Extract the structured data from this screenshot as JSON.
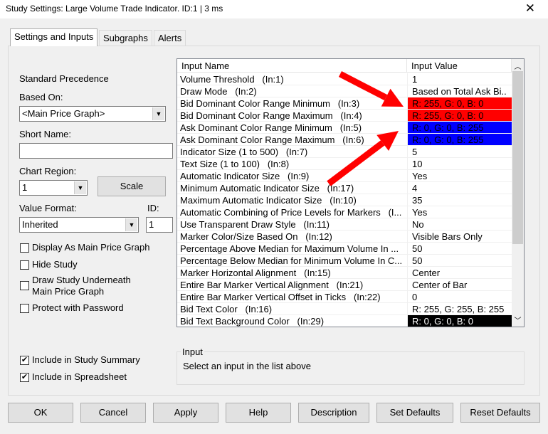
{
  "window": {
    "title": "Study Settings: Large Volume Trade Indicator. ID:1 | 3 ms",
    "close": "✕"
  },
  "tabs": [
    "Settings and Inputs",
    "Subgraphs",
    "Alerts"
  ],
  "left": {
    "standard_precedence": "Standard Precedence",
    "based_on_label": "Based On:",
    "based_on_value": "<Main Price Graph>",
    "short_name_label": "Short Name:",
    "short_name_value": "",
    "chart_region_label": "Chart Region:",
    "chart_region_value": "1",
    "scale_button": "Scale",
    "value_format_label": "Value Format:",
    "value_format_value": "Inherited",
    "id_label": "ID:",
    "id_value": "1",
    "checkboxes": [
      {
        "label": "Display As Main Price Graph",
        "checked": false
      },
      {
        "label": "Hide Study",
        "checked": false
      },
      {
        "label": "Draw Study Underneath Main Price Graph",
        "checked": false
      },
      {
        "label": "Protect with Password",
        "checked": false
      }
    ],
    "include_summary": {
      "label": "Include in Study Summary",
      "checked": true
    },
    "include_spreadsheet": {
      "label": "Include in Spreadsheet",
      "checked": true
    }
  },
  "inputs": {
    "columns": [
      "Input Name",
      "Input Value"
    ],
    "rows": [
      {
        "name": "Volume Threshold   (In:1)",
        "value": "1"
      },
      {
        "name": "Draw Mode   (In:2)",
        "value": "Based on Total Ask Bi.."
      },
      {
        "name": "Bid Dominant Color Range Minimum   (In:3)",
        "value": "R: 255, G: 0, B: 0",
        "bg": "#ff0000"
      },
      {
        "name": "Bid Dominant Color Range Maximum   (In:4)",
        "value": "R: 255, G: 0, B: 0",
        "bg": "#ff0000"
      },
      {
        "name": "Ask Dominant Color Range Minimum   (In:5)",
        "value": "R: 0, G: 0, B: 255",
        "bg": "#0000ff"
      },
      {
        "name": "Ask Dominant Color Range Maximum   (In:6)",
        "value": "R: 0, G: 0, B: 255",
        "bg": "#0000ff"
      },
      {
        "name": "Indicator Size (1 to 500)   (In:7)",
        "value": "5"
      },
      {
        "name": "Text Size (1 to 100)   (In:8)",
        "value": "10"
      },
      {
        "name": "Automatic Indicator Size   (In:9)",
        "value": "Yes"
      },
      {
        "name": "Minimum Automatic Indicator Size   (In:17)",
        "value": "4"
      },
      {
        "name": "Maximum Automatic Indicator Size   (In:10)",
        "value": "35"
      },
      {
        "name": "Automatic Combining of Price Levels for Markers   (I...",
        "value": "Yes"
      },
      {
        "name": "Use Transparent Draw Style   (In:11)",
        "value": "No"
      },
      {
        "name": "Marker Color/Size Based On   (In:12)",
        "value": "Visible Bars Only"
      },
      {
        "name": "Percentage Above Median for Maximum Volume In ...",
        "value": "50"
      },
      {
        "name": "Percentage Below Median for Minimum Volume In C...",
        "value": "50"
      },
      {
        "name": "Marker Horizontal Alignment   (In:15)",
        "value": "Center"
      },
      {
        "name": "Entire Bar Marker Vertical Alignment   (In:21)",
        "value": "Center of Bar"
      },
      {
        "name": "Entire Bar Marker Vertical Offset in Ticks   (In:22)",
        "value": "0"
      },
      {
        "name": "Bid Text Color   (In:16)",
        "value": "R: 255, G: 255, B: 255"
      },
      {
        "name": "Bid Text Background Color   (In:29)",
        "value": "R: 0, G: 0, B: 0",
        "bg": "#000000",
        "fg": "#ffffff"
      }
    ]
  },
  "input_group": {
    "title": "Input",
    "hint": "Select an input in the list above"
  },
  "buttons": [
    "OK",
    "Cancel",
    "Apply",
    "Help",
    "Description",
    "Set Defaults",
    "Reset Defaults"
  ],
  "colors": {
    "arrow": "#ff0000"
  }
}
